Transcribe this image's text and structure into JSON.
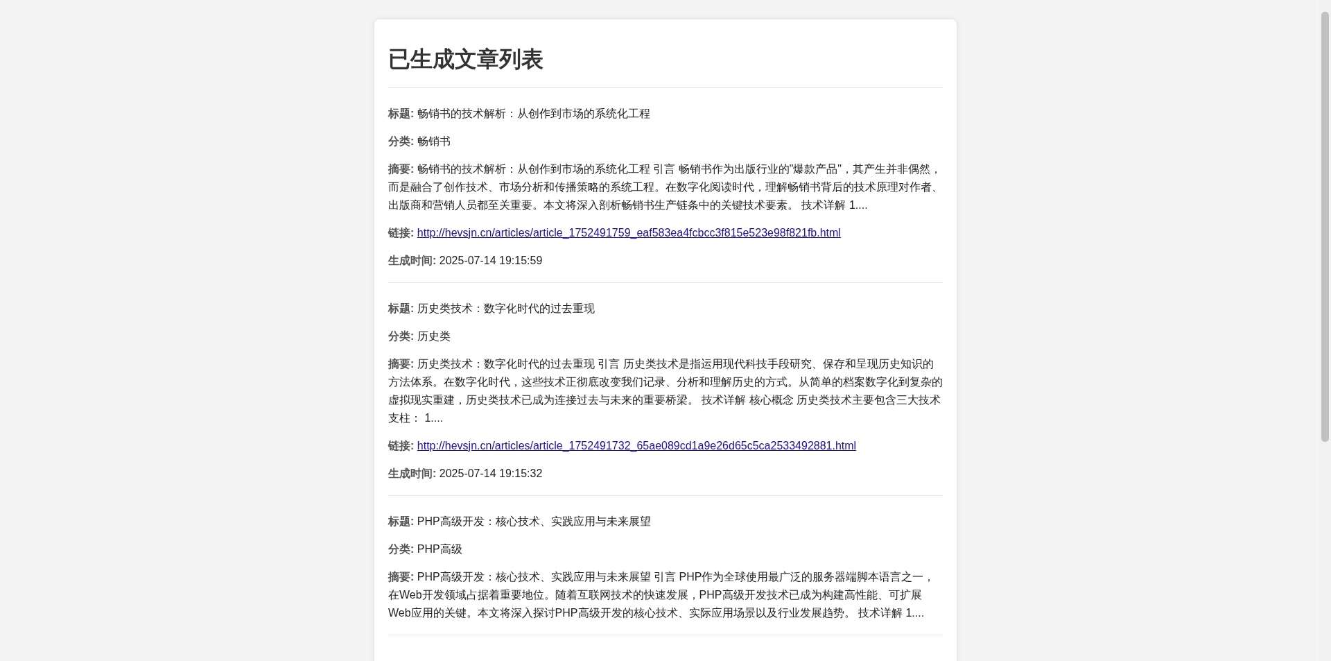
{
  "page": {
    "heading": "已生成文章列表"
  },
  "articles": [
    {
      "title_label": "标题:",
      "title": "畅销书的技术解析：从创作到市场的系统化工程",
      "category_label": "分类:",
      "category": "畅销书",
      "summary_label": "摘要:",
      "summary": "畅销书的技术解析：从创作到市场的系统化工程 引言 畅销书作为出版行业的\"爆款产品\"，其产生并非偶然，而是融合了创作技术、市场分析和传播策略的系统工程。在数字化阅读时代，理解畅销书背后的技术原理对作者、出版商和营销人员都至关重要。本文将深入剖析畅销书生产链条中的关键技术要素。 技术详解 1....",
      "link_label": "链接:",
      "link": "http://hevsjn.cn/articles/article_1752491759_eaf583ea4fcbcc3f815e523e98f821fb.html",
      "time_label": "生成时间:",
      "time": "2025-07-14 19:15:59"
    },
    {
      "title_label": "标题:",
      "title": "历史类技术：数字化时代的过去重现",
      "category_label": "分类:",
      "category": "历史类",
      "summary_label": "摘要:",
      "summary": "历史类技术：数字化时代的过去重现 引言 历史类技术是指运用现代科技手段研究、保存和呈现历史知识的方法体系。在数字化时代，这些技术正彻底改变我们记录、分析和理解历史的方式。从简单的档案数字化到复杂的虚拟现实重建，历史类技术已成为连接过去与未来的重要桥梁。 技术详解 核心概念 历史类技术主要包含三大技术支柱： 1....",
      "link_label": "链接:",
      "link": "http://hevsjn.cn/articles/article_1752491732_65ae089cd1a9e26d65c5ca2533492881.html",
      "time_label": "生成时间:",
      "time": "2025-07-14 19:15:32"
    },
    {
      "title_label": "标题:",
      "title": "PHP高级开发：核心技术、实践应用与未来展望",
      "category_label": "分类:",
      "category": "PHP高级",
      "summary_label": "摘要:",
      "summary": "PHP高级开发：核心技术、实践应用与未来展望 引言 PHP作为全球使用最广泛的服务器端脚本语言之一，在Web开发领域占据着重要地位。随着互联网技术的快速发展，PHP高级开发技术已成为构建高性能、可扩展Web应用的关键。本文将深入探讨PHP高级开发的核心技术、实际应用场景以及行业发展趋势。 技术详解 1...."
    }
  ]
}
